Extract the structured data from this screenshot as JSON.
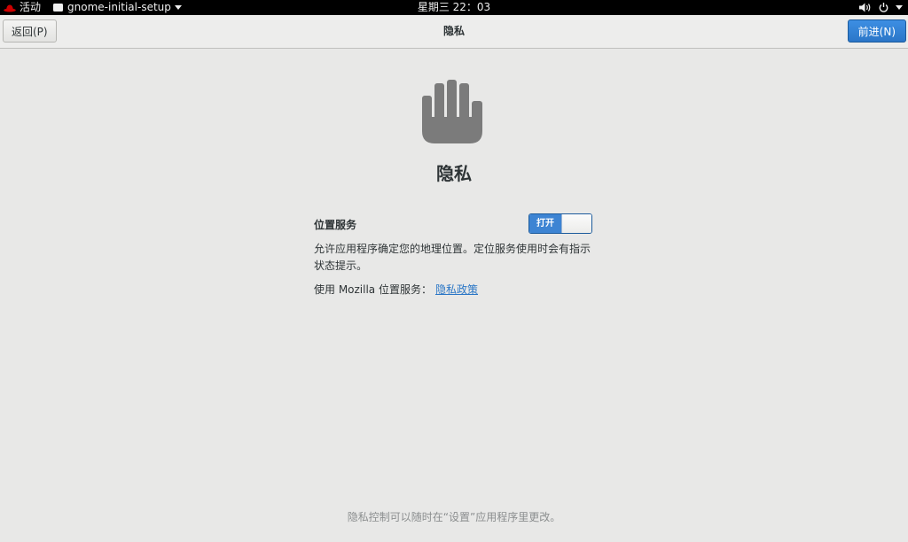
{
  "topbar": {
    "activities": "活动",
    "app_name": "gnome-initial-setup",
    "clock": "星期三 22：03"
  },
  "header": {
    "back_label": "返回(P)",
    "title": "隐私",
    "next_label": "前进(N)"
  },
  "main": {
    "icon": "hand-stop-icon",
    "heading": "隐私",
    "location_label": "位置服务",
    "switch_state": "打开",
    "description": "允许应用程序确定您的地理位置。定位服务使用时会有指示状态提示。",
    "mozilla_text": "使用 Mozilla 位置服务：",
    "privacy_policy_link": "隐私政策"
  },
  "footer": {
    "note": "隐私控制可以随时在“设置”应用程序里更改。"
  },
  "colors": {
    "accent": "#3d84d3",
    "link": "#2a76c6",
    "background": "#e8e8e7",
    "icon_gray": "#7b7b7b"
  }
}
